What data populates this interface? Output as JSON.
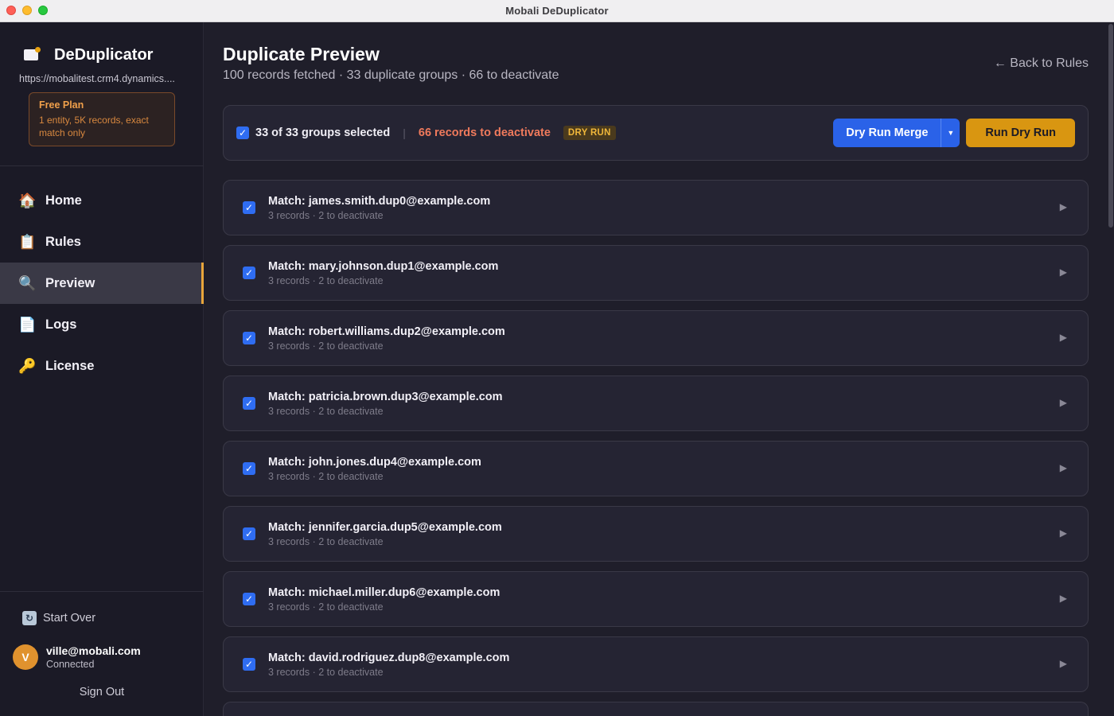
{
  "window": {
    "title": "Mobali DeDuplicator"
  },
  "sidebar": {
    "brand": "DeDuplicator",
    "org_url": "https://mobalitest.crm4.dynamics....",
    "plan": {
      "title": "Free Plan",
      "description": "1 entity, 5K records, exact match only"
    },
    "nav": [
      {
        "label": "Home",
        "icon": "home-icon",
        "active": false
      },
      {
        "label": "Rules",
        "icon": "clipboard-icon",
        "active": false
      },
      {
        "label": "Preview",
        "icon": "magnifier-icon",
        "active": true
      },
      {
        "label": "Logs",
        "icon": "document-icon",
        "active": false
      },
      {
        "label": "License",
        "icon": "key-icon",
        "active": false
      }
    ],
    "start_over": "Start Over",
    "user": {
      "initial": "V",
      "email": "ville@mobali.com",
      "status": "Connected"
    },
    "sign_out": "Sign Out"
  },
  "main": {
    "title": "Duplicate Preview",
    "subtitle": "100 records fetched · 33 duplicate groups · 66 to deactivate",
    "back_link": "← Back to Rules",
    "toolbar": {
      "selected_text": "33 of 33 groups selected",
      "separator": "|",
      "deactivate_text": "66 records to deactivate",
      "badge": "DRY RUN",
      "dry_run_merge": "Dry Run Merge",
      "run_dry_run": "Run Dry Run"
    },
    "groups": [
      {
        "title": "Match: james.smith.dup0@example.com",
        "meta": "3 records · 2 to deactivate"
      },
      {
        "title": "Match: mary.johnson.dup1@example.com",
        "meta": "3 records · 2 to deactivate"
      },
      {
        "title": "Match: robert.williams.dup2@example.com",
        "meta": "3 records · 2 to deactivate"
      },
      {
        "title": "Match: patricia.brown.dup3@example.com",
        "meta": "3 records · 2 to deactivate"
      },
      {
        "title": "Match: john.jones.dup4@example.com",
        "meta": "3 records · 2 to deactivate"
      },
      {
        "title": "Match: jennifer.garcia.dup5@example.com",
        "meta": "3 records · 2 to deactivate"
      },
      {
        "title": "Match: michael.miller.dup6@example.com",
        "meta": "3 records · 2 to deactivate"
      },
      {
        "title": "Match: david.rodriguez.dup8@example.com",
        "meta": "3 records · 2 to deactivate"
      }
    ]
  },
  "colors": {
    "accent_blue": "#2a62e8",
    "accent_gold": "#d99611",
    "warning_red": "#f07a5c",
    "active_border": "#e8a53b"
  }
}
